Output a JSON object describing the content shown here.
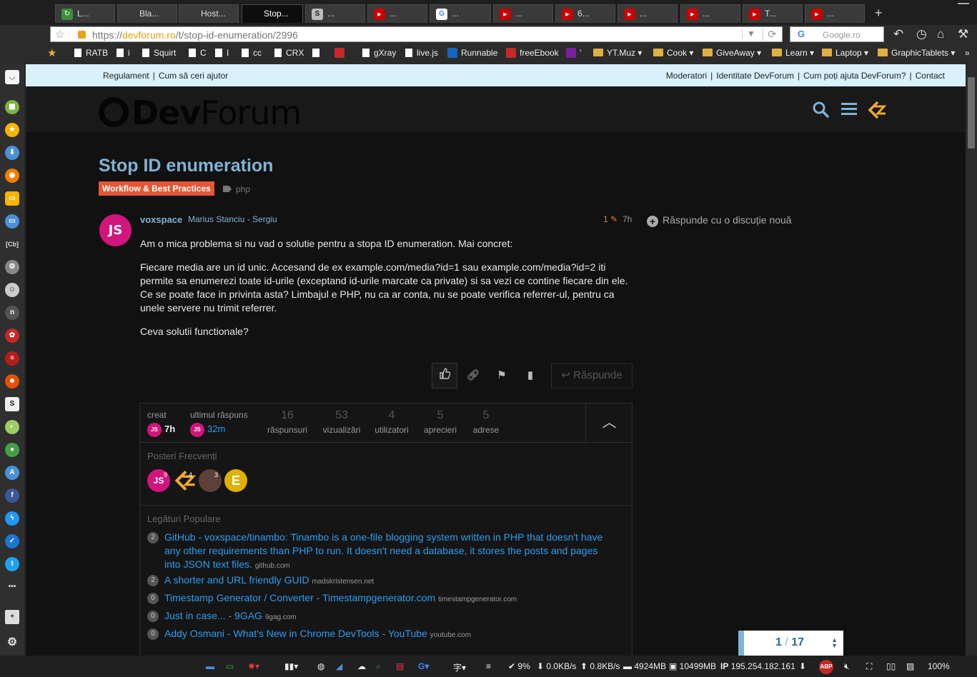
{
  "browser": {
    "tabs": [
      {
        "label": "L...",
        "icon": "refresh-green"
      },
      {
        "label": "Bla...",
        "icon": "none"
      },
      {
        "label": "Host...",
        "icon": "none"
      },
      {
        "label": "Stop...",
        "icon": "none",
        "active": true
      },
      {
        "label": "...",
        "icon": "s-square"
      },
      {
        "label": "...",
        "icon": "youtube"
      },
      {
        "label": "...",
        "icon": "google"
      },
      {
        "label": "...",
        "icon": "youtube"
      },
      {
        "label": "6...",
        "icon": "youtube"
      },
      {
        "label": "...",
        "icon": "youtube"
      },
      {
        "label": "...",
        "icon": "youtube"
      },
      {
        "label": "T...",
        "icon": "youtube"
      },
      {
        "label": "...",
        "icon": "youtube"
      }
    ],
    "url_prefix": "https://",
    "url_domain": "devforum.ro",
    "url_path": "/t/stop-id-enumeration/2996",
    "search_placeholder": "Google.ro",
    "bookmarks": [
      {
        "label": "RATB",
        "kind": "page"
      },
      {
        "label": "i",
        "kind": "page"
      },
      {
        "label": "Squirt",
        "kind": "page"
      },
      {
        "label": "C",
        "kind": "page"
      },
      {
        "label": "I",
        "kind": "page"
      },
      {
        "label": "cc",
        "kind": "page"
      },
      {
        "label": "CRX",
        "kind": "page"
      },
      {
        "label": "",
        "kind": "page"
      },
      {
        "label": "",
        "kind": "icon"
      },
      {
        "label": "gXray",
        "kind": "page"
      },
      {
        "label": "live.js",
        "kind": "page"
      },
      {
        "label": "Runnable",
        "kind": "icon"
      },
      {
        "label": "freeEbook",
        "kind": "icon"
      },
      {
        "label": "'",
        "kind": "icon"
      },
      {
        "label": "YT.Muz ▾",
        "kind": "folder"
      },
      {
        "label": "Cook ▾",
        "kind": "folder"
      },
      {
        "label": "GiveAway ▾",
        "kind": "folder"
      },
      {
        "label": "Learn ▾",
        "kind": "folder"
      },
      {
        "label": "Laptop ▾",
        "kind": "folder"
      },
      {
        "label": "GraphicTablets ▾",
        "kind": "folder"
      }
    ]
  },
  "site": {
    "top_links_left": [
      "Regulament",
      "Cum să ceri ajutor"
    ],
    "top_links_right": [
      "Moderatori",
      "Identitate DevForum",
      "Cum poți ajuta DevForum?",
      "Contact"
    ],
    "logo_dev": "Dev",
    "logo_forum": "Forum"
  },
  "topic": {
    "title": "Stop ID enumeration",
    "category": "Workflow & Best Practices",
    "category_color": "#e45735",
    "tag": "php",
    "reply_new": "Răspunde cu o discuție nouă"
  },
  "post": {
    "avatar_letters": "JS",
    "username": "voxspace",
    "full_name": "Marius Stanciu - Sergiu",
    "edits": "1",
    "age": "7h",
    "paragraphs": [
      "Am o mica problema si nu vad o solutie pentru a stopa ID enumeration. Mai concret:",
      "Fiecare media are un id unic. Accesand de ex example.com/media?id=1 sau example.com/media?id=2 iti permite sa enumerezi toate id-urile (exceptand id-urile marcate ca private) si sa vezi ce contine fiecare din ele. Ce se poate face in privinta asta? Limbajul e PHP, nu ca ar conta, nu se poate verifica referrer-ul, pentru ca unele servere nu trimit referrer.",
      "Ceva solutii functionale?"
    ],
    "reply_label": "Răspunde"
  },
  "summary": {
    "created_label": "creat",
    "created_time": "7h",
    "last_reply_label": "ultimul răspuns",
    "last_reply_time": "32m",
    "stats": [
      {
        "value": "16",
        "label": "răspunsuri"
      },
      {
        "value": "53",
        "label": "vizualizări"
      },
      {
        "value": "4",
        "label": "utilizatori"
      },
      {
        "value": "5",
        "label": "aprecieri"
      },
      {
        "value": "5",
        "label": "adrese"
      }
    ],
    "frequent_posters_label": "Posteri Frecvenți",
    "posters": [
      {
        "letters": "JS",
        "count": "9"
      },
      {
        "letters": "",
        "count": "4"
      },
      {
        "letters": "",
        "count": "3"
      },
      {
        "letters": "E",
        "count": ""
      }
    ],
    "popular_links_label": "Legături Populare",
    "links": [
      {
        "count": "2",
        "title": "GitHub - voxspace/tinambo: Tinambo is a one-file blogging system written in PHP that doesn't have any other requirements than PHP to run. It doesn't need a database, it stores the posts and pages into JSON text files.",
        "domain": "github.com"
      },
      {
        "count": "2",
        "title": "A shorter and URL friendly GUID",
        "domain": "madskristensen.net"
      },
      {
        "count": "0",
        "title": "Timestamp Generator / Converter - Timestampgenerator.com",
        "domain": "timestampgenerator.com"
      },
      {
        "count": "0",
        "title": "Just in case... - 9GAG",
        "domain": "9gag.com"
      },
      {
        "count": "0",
        "title": "Addy Osmani - What's New in Chrome DevTools - YouTube",
        "domain": "youtube.com"
      }
    ]
  },
  "timeline": {
    "current": "1",
    "total": "17"
  },
  "statusbar": {
    "cpu": "9%",
    "down": "0.0KB/s",
    "up": "0.8KB/s",
    "mem": "4924MB",
    "disk": "10499MB",
    "ip_label": "IP",
    "ip": "195.254.182.161",
    "adblock": "ABP",
    "zoom": "100%"
  }
}
